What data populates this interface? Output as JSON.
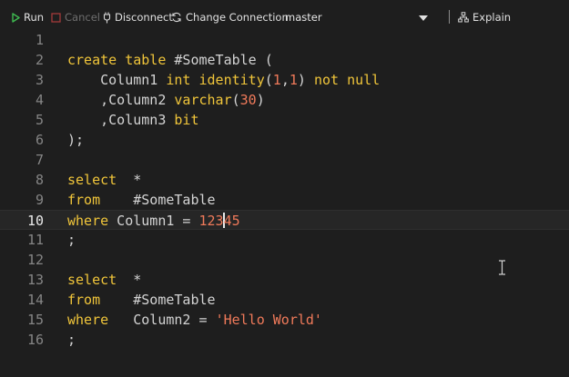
{
  "toolbar": {
    "run_label": "Run",
    "cancel_label": "Cancel",
    "disconnect_label": "Disconnect",
    "change_connection_label": "Change Connection",
    "database": "master",
    "explain_label": "Explain"
  },
  "editor": {
    "lines": [
      {
        "n": "1"
      },
      {
        "n": "2",
        "t": [
          [
            "kw",
            "create"
          ],
          [
            "",
            " "
          ],
          [
            "kw",
            "table"
          ],
          [
            "",
            " #SomeTable ("
          ]
        ]
      },
      {
        "n": "3",
        "t": [
          [
            "",
            "    Column1 "
          ],
          [
            "kw",
            "int"
          ],
          [
            "",
            " "
          ],
          [
            "kw",
            "identity"
          ],
          [
            "",
            "("
          ],
          [
            "num",
            "1"
          ],
          [
            "",
            ","
          ],
          [
            "num",
            "1"
          ],
          [
            "",
            ") "
          ],
          [
            "kw",
            "not"
          ],
          [
            "",
            " "
          ],
          [
            "kw",
            "null"
          ]
        ]
      },
      {
        "n": "4",
        "t": [
          [
            "",
            "    ,Column2 "
          ],
          [
            "kw",
            "varchar"
          ],
          [
            "",
            "("
          ],
          [
            "num",
            "30"
          ],
          [
            "",
            ")"
          ]
        ]
      },
      {
        "n": "5",
        "t": [
          [
            "",
            "    ,Column3 "
          ],
          [
            "kw",
            "bit"
          ]
        ]
      },
      {
        "n": "6",
        "t": [
          [
            "",
            ");"
          ]
        ]
      },
      {
        "n": "7"
      },
      {
        "n": "8",
        "t": [
          [
            "kw",
            "select"
          ],
          [
            "",
            "  *"
          ]
        ]
      },
      {
        "n": "9",
        "t": [
          [
            "kw",
            "from"
          ],
          [
            "",
            "    #SomeTable"
          ]
        ]
      },
      {
        "n": "10",
        "current": true,
        "t": [
          [
            "kw",
            "where"
          ],
          [
            "",
            " Column1 = "
          ],
          [
            "num",
            "123"
          ],
          [
            "cursor",
            ""
          ],
          [
            "num",
            "45"
          ]
        ]
      },
      {
        "n": "11",
        "t": [
          [
            "",
            ";"
          ]
        ]
      },
      {
        "n": "12"
      },
      {
        "n": "13",
        "t": [
          [
            "kw",
            "select"
          ],
          [
            "",
            "  *"
          ]
        ]
      },
      {
        "n": "14",
        "t": [
          [
            "kw",
            "from"
          ],
          [
            "",
            "    #SomeTable"
          ]
        ]
      },
      {
        "n": "15",
        "t": [
          [
            "kw",
            "where"
          ],
          [
            "",
            "   Column2 = "
          ],
          [
            "str",
            "'Hello World'"
          ]
        ]
      },
      {
        "n": "16",
        "t": [
          [
            "",
            ";"
          ]
        ]
      }
    ]
  },
  "colors": {
    "background": "#1e1e1e",
    "keyword": "#f0c53a",
    "number": "#f07a5a",
    "run_icon": "#3fb950"
  }
}
